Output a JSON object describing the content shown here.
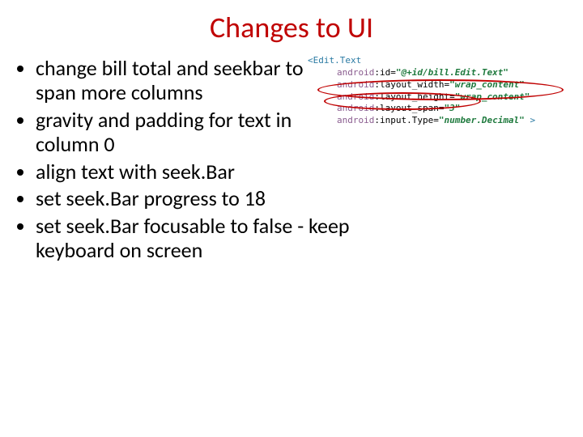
{
  "title": "Changes to UI",
  "bullets": [
    "change bill total and seekbar to span more columns",
    "gravity and padding for text in column 0",
    "align text with seek.Bar",
    "set seek.Bar progress to 18",
    "set seek.Bar focusable to false - keep keyboard on screen"
  ],
  "code": {
    "tag_open": "<Edit.Text",
    "tag_close": ">",
    "ns": "android",
    "attrs": [
      {
        "name": "id",
        "value": "\"@+id/bill.Edit.Text\""
      },
      {
        "name": "layout_width",
        "value": "\"wrap_content\""
      },
      {
        "name": "layout_height",
        "value": "\"wrap_content\""
      },
      {
        "name": "layout_span",
        "value": "\"3\""
      },
      {
        "name": "input.Type",
        "value": "\"number.Decimal\""
      }
    ]
  }
}
